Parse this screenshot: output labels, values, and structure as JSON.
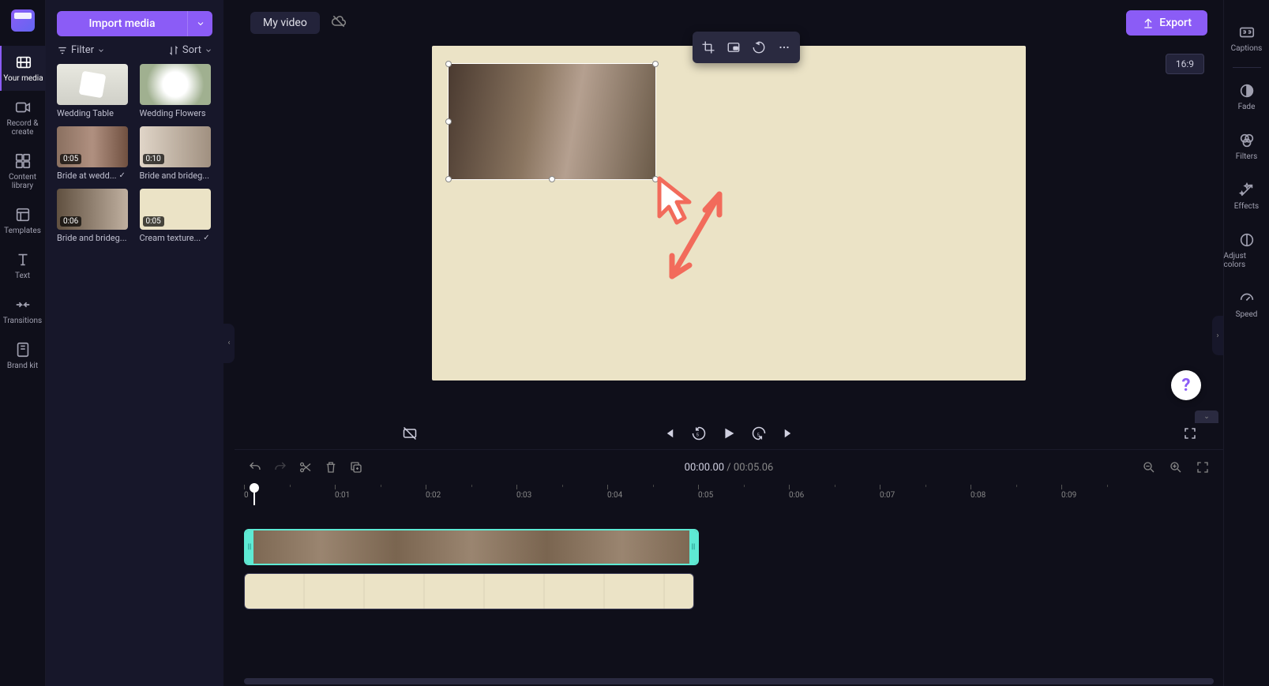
{
  "header": {
    "title": "My video",
    "export_label": "Export",
    "aspect_ratio": "16:9"
  },
  "import": {
    "button_label": "Import media"
  },
  "filter_sort": {
    "filter_label": "Filter",
    "sort_label": "Sort"
  },
  "nav": {
    "your_media": "Your media",
    "record_create": "Record & create",
    "content_library": "Content library",
    "templates": "Templates",
    "text": "Text",
    "transitions": "Transitions",
    "brand_kit": "Brand kit"
  },
  "media": {
    "items": [
      {
        "label": "Wedding Table",
        "duration": "",
        "used": false
      },
      {
        "label": "Wedding Flowers",
        "duration": "",
        "used": false
      },
      {
        "label": "Bride at wedd...",
        "duration": "0:05",
        "used": true
      },
      {
        "label": "Bride and brideg...",
        "duration": "0:10",
        "used": false
      },
      {
        "label": "Bride and brideg...",
        "duration": "0:06",
        "used": false
      },
      {
        "label": "Cream texture...",
        "duration": "0:05",
        "used": true
      }
    ]
  },
  "right_rail": {
    "captions": "Captions",
    "fade": "Fade",
    "filters": "Filters",
    "effects": "Effects",
    "adjust_colors": "Adjust colors",
    "speed": "Speed"
  },
  "playback": {
    "current_time": "00:00.00",
    "separator": " / ",
    "duration": "00:05.06"
  },
  "ruler": {
    "ticks": [
      "0",
      "0:01",
      "0:02",
      "0:03",
      "0:04",
      "0:05",
      "0:06",
      "0:07",
      "0:08",
      "0:09"
    ]
  },
  "colors": {
    "accent": "#8b5cf6",
    "canvas_bg": "#ebe3c6",
    "selection": "#5eead4"
  },
  "help": {
    "label": "?"
  }
}
